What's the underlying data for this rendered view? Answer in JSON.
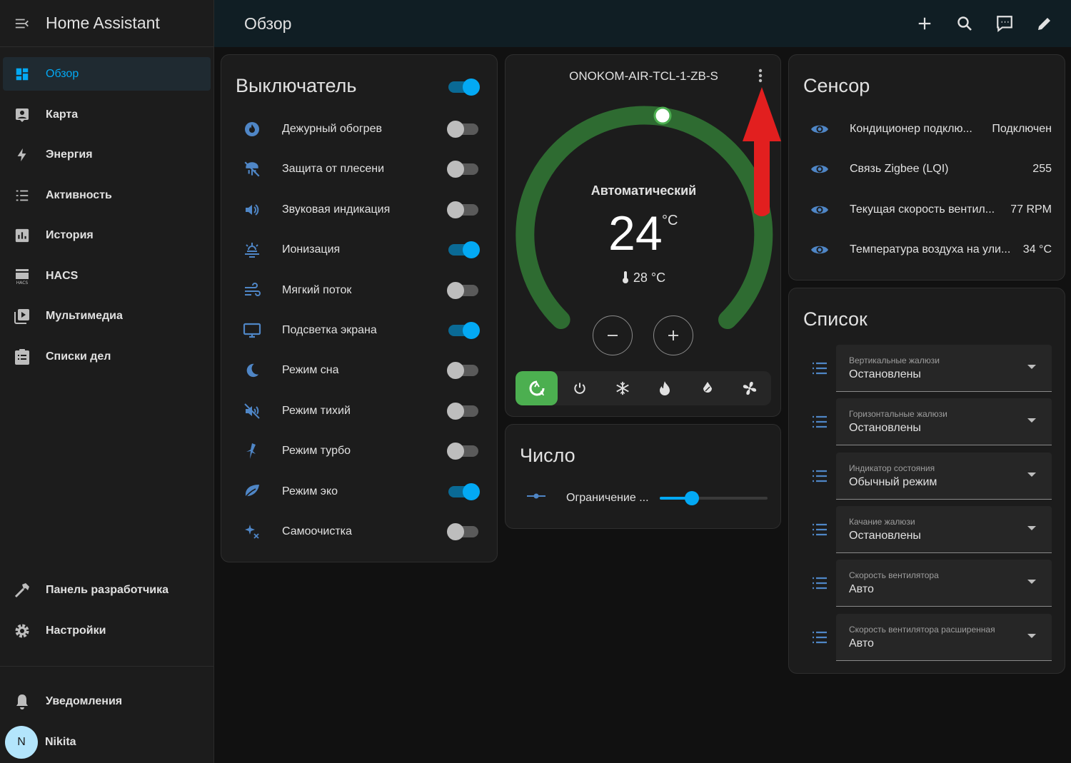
{
  "sidebar": {
    "title": "Home Assistant",
    "items": [
      {
        "label": "Обзор",
        "icon": "dashboard-icon",
        "active": true
      },
      {
        "label": "Карта",
        "icon": "map-account-icon"
      },
      {
        "label": "Энергия",
        "icon": "lightning-icon"
      },
      {
        "label": "Активность",
        "icon": "list-icon"
      },
      {
        "label": "История",
        "icon": "chart-box-icon"
      },
      {
        "label": "HACS",
        "icon": "hacs-icon"
      },
      {
        "label": "Мультимедиа",
        "icon": "play-box-multiple-icon"
      },
      {
        "label": "Списки дел",
        "icon": "clipboard-list-icon"
      }
    ],
    "bottom_items": [
      {
        "label": "Панель разработчика",
        "icon": "hammer-icon"
      },
      {
        "label": "Настройки",
        "icon": "cog-icon"
      }
    ],
    "notifications_label": "Уведомления",
    "user": {
      "initial": "N",
      "name": "Nikita"
    }
  },
  "header": {
    "title": "Обзор",
    "actions": [
      "plus-icon",
      "search-icon",
      "assist-icon",
      "pencil-icon"
    ]
  },
  "switch_card": {
    "title": "Выключатель",
    "master_on": true,
    "items": [
      {
        "label": "Дежурный обогрев",
        "icon": "fire-circle-icon",
        "on": false
      },
      {
        "label": "Защита от плесени",
        "icon": "mold-off-icon",
        "on": false
      },
      {
        "label": "Звуковая индикация",
        "icon": "volume-icon",
        "on": false
      },
      {
        "label": "Ионизация",
        "icon": "ionization-icon",
        "on": true
      },
      {
        "label": "Мягкий поток",
        "icon": "soft-wind-icon",
        "on": false
      },
      {
        "label": "Подсветка экрана",
        "icon": "monitor-icon",
        "on": true
      },
      {
        "label": "Режим сна",
        "icon": "moon-icon",
        "on": false
      },
      {
        "label": "Режим тихий",
        "icon": "volume-off-icon",
        "on": false
      },
      {
        "label": "Режим турбо",
        "icon": "turbo-icon",
        "on": false
      },
      {
        "label": "Режим эко",
        "icon": "leaf-icon",
        "on": true
      },
      {
        "label": "Самоочистка",
        "icon": "sparkles-icon",
        "on": false
      }
    ]
  },
  "thermostat": {
    "name": "ONOKOM-AIR-TCL-1-ZB-S",
    "mode_label": "Автоматический",
    "target": "24",
    "target_unit": "°C",
    "current": "28 °C",
    "modes": [
      "auto-icon",
      "power-icon",
      "snowflake-icon",
      "fire-icon",
      "water-percent-icon",
      "fan-icon"
    ],
    "active_mode": 0,
    "accent_color": "#4caf50"
  },
  "number_card": {
    "title": "Число",
    "item_label": "Ограничение ...",
    "slider_fraction": 0.3
  },
  "sensor_card": {
    "title": "Сенсор",
    "items": [
      {
        "label": "Кондиционер подклю...",
        "value": "Подключен"
      },
      {
        "label": "Связь Zigbee (LQI)",
        "value": "255"
      },
      {
        "label": "Текущая скорость вентил...",
        "value": "77 RPM"
      },
      {
        "label": "Температура воздуха на ули...",
        "value": "34 °C"
      }
    ]
  },
  "list_card": {
    "title": "Список",
    "items": [
      {
        "caption": "Вертикальные жалюзи",
        "value": "Остановлены"
      },
      {
        "caption": "Горизонтальные жалюзи",
        "value": "Остановлены"
      },
      {
        "caption": "Индикатор состояния",
        "value": "Обычный режим"
      },
      {
        "caption": "Качание жалюзи",
        "value": "Остановлены"
      },
      {
        "caption": "Скорость вентилятора",
        "value": "Авто"
      },
      {
        "caption": "Скорость вентилятора расширенная",
        "value": "Авто"
      }
    ]
  },
  "colors": {
    "accent": "#03a9f4",
    "icon": "#4f86c6",
    "annotation_arrow": "#e21f1f"
  }
}
